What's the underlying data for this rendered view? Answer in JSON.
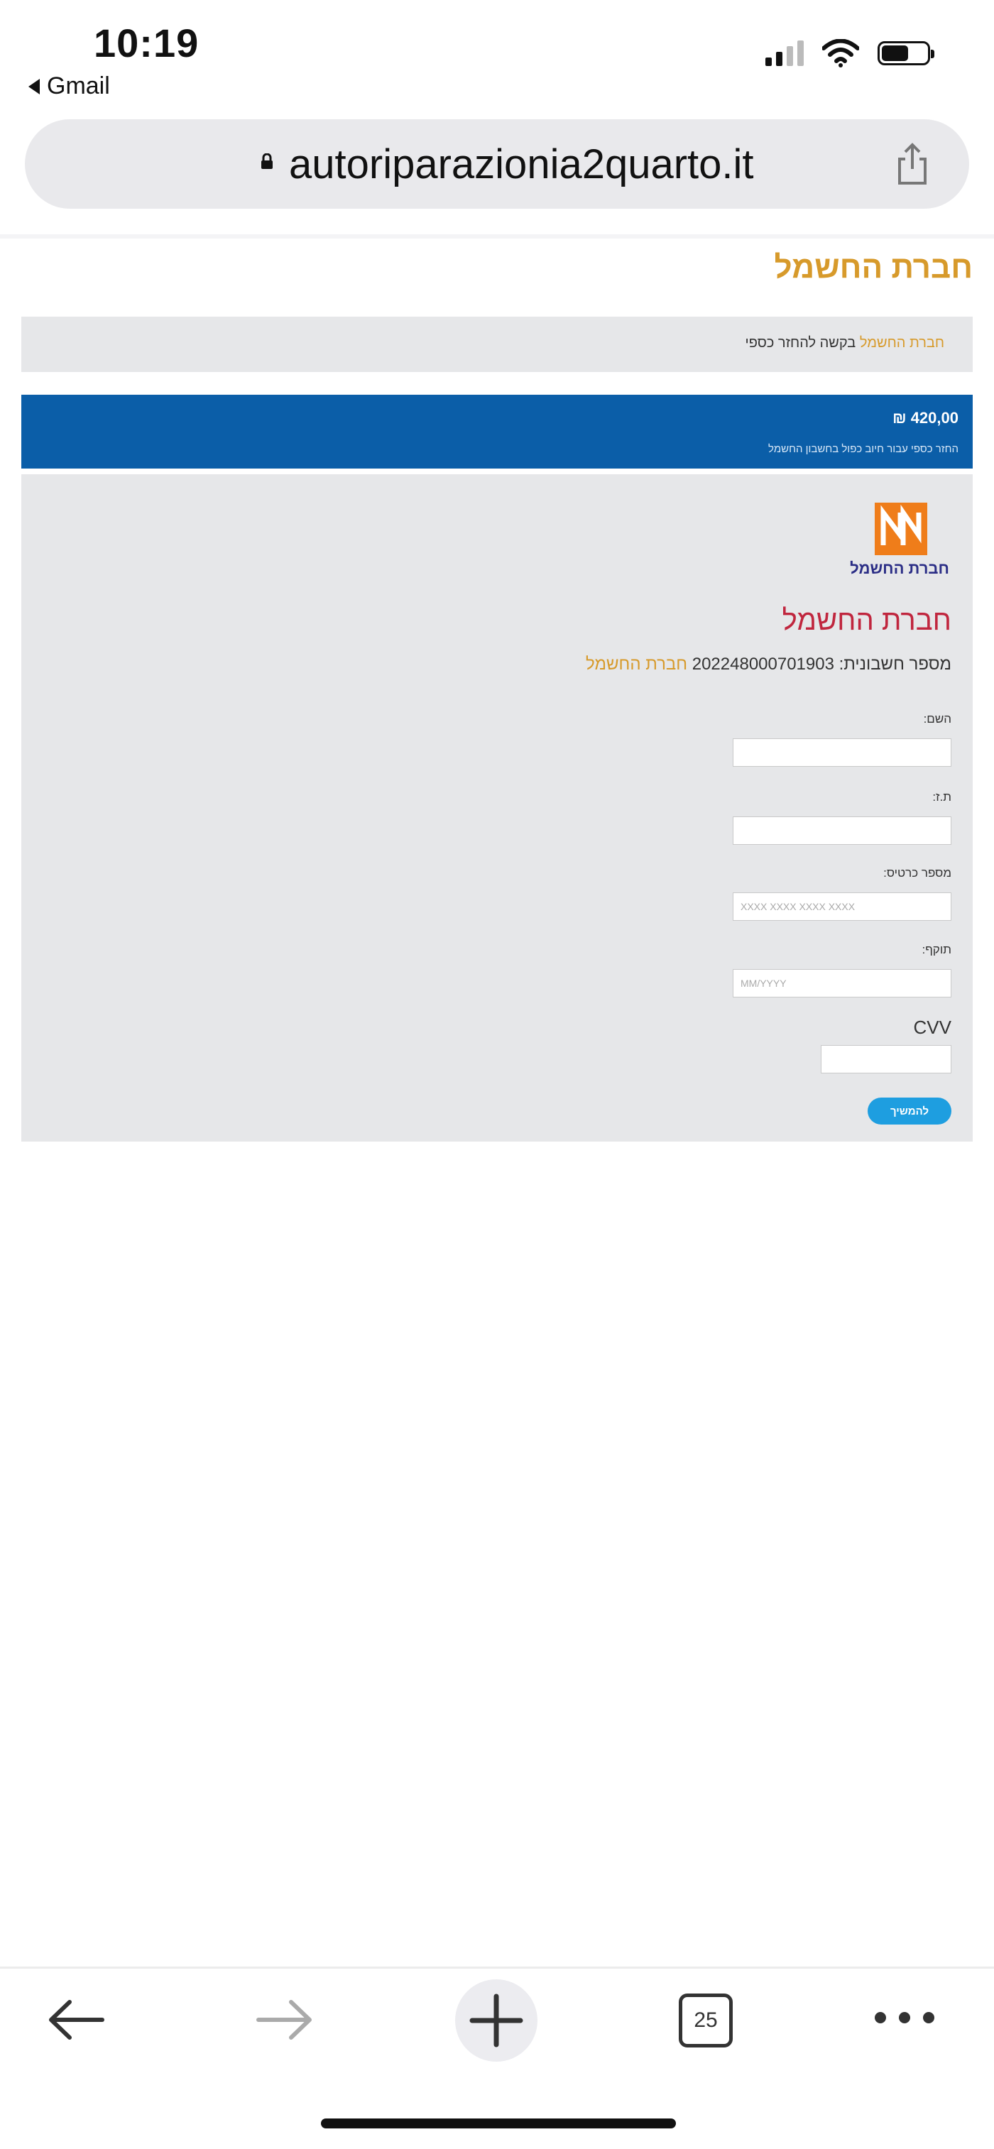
{
  "status_bar": {
    "time": "10:19",
    "back_app": "Gmail"
  },
  "browser": {
    "url": "autoriparazionia2quarto.it"
  },
  "site": {
    "title": "חברת החשמל"
  },
  "breadcrumb": {
    "link": "חברת החשמל",
    "current": "בקשה להחזר כספי"
  },
  "payment_header": {
    "amount": "₪ 420,00",
    "subtitle": "החזר כספי עבור חיוב כפול בחשבון החשמל"
  },
  "company": {
    "logo_text": "חברת החשמל",
    "heading": "חברת החשמל",
    "account_label": "מספר חשבונית:",
    "account_number": "202248000701903",
    "account_company": "חברת החשמל"
  },
  "form": {
    "name_label": "השם:",
    "id_label": "ת.ז:",
    "card_label": "מספר כרטיס:",
    "card_placeholder": "XXXX XXXX XXXX XXXX",
    "expiry_label": "תוקף:",
    "expiry_placeholder": "MM/YYYY",
    "cvv_label": "CVV",
    "submit_label": "להמשיך"
  },
  "toolbar": {
    "tab_count": "25"
  }
}
